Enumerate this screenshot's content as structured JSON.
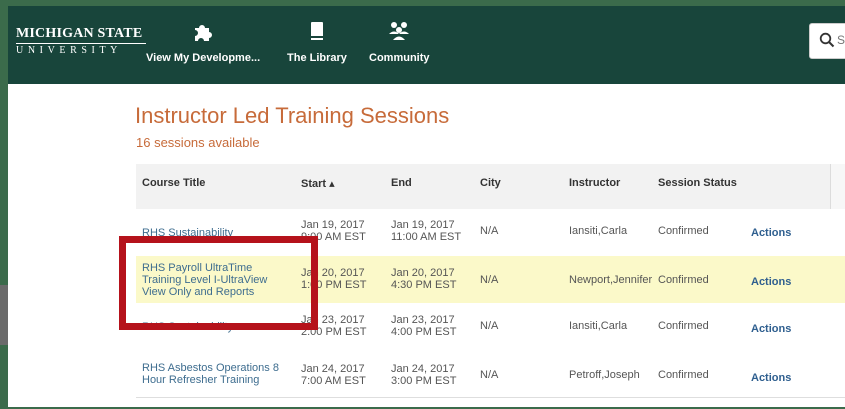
{
  "brand": {
    "line1": "MICHIGAN STATE",
    "line2": "UNIVERSITY"
  },
  "nav": [
    {
      "label": "View My Developme...",
      "icon": "puzzle-icon"
    },
    {
      "label": "The Library",
      "icon": "book-icon"
    },
    {
      "label": "Community",
      "icon": "people-icon"
    }
  ],
  "search": {
    "placeholder": "Se",
    "icon": "search-icon"
  },
  "page": {
    "title": "Instructor Led Training Sessions",
    "count": "16 sessions available"
  },
  "table": {
    "columns": [
      "Course Title",
      "Start ▴",
      "End",
      "City",
      "Instructor",
      "Session Status"
    ],
    "rows": [
      {
        "title": "RHS Sustainability",
        "start_date": "Jan 19, 2017",
        "start_time": "9:00 AM EST",
        "end_date": "Jan 19, 2017",
        "end_time": "11:00 AM EST",
        "city": "N/A",
        "instructor": "Iansiti,Carla",
        "status": "Confirmed",
        "action": "Actions"
      },
      {
        "title": "RHS Payroll UltraTime Training Level I-UltraView View Only and Reports",
        "start_date": "Jan 20, 2017",
        "start_time": "1:00 PM EST",
        "end_date": "Jan 20, 2017",
        "end_time": "4:30 PM EST",
        "city": "N/A",
        "instructor": "Newport,Jennifer",
        "status": "Confirmed",
        "action": "Actions"
      },
      {
        "title": "RHS Sustainability",
        "start_date": "Jan 23, 2017",
        "start_time": "2:00 PM EST",
        "end_date": "Jan 23, 2017",
        "end_time": "4:00 PM EST",
        "city": "N/A",
        "instructor": "Iansiti,Carla",
        "status": "Confirmed",
        "action": "Actions"
      },
      {
        "title": "RHS Asbestos Operations 8 Hour Refresher Training",
        "start_date": "Jan 24, 2017",
        "start_time": "7:00 AM EST",
        "end_date": "Jan 24, 2017",
        "end_time": "3:00 PM EST",
        "city": "N/A",
        "instructor": "Petroff,Joseph",
        "status": "Confirmed",
        "action": "Actions"
      }
    ]
  },
  "colors": {
    "nav_bg": "#18453b",
    "title_accent": "#c76b3a",
    "link": "#3e6d8f",
    "highlight_row": "#fbf9c9",
    "annotation_red": "#b5121b"
  }
}
